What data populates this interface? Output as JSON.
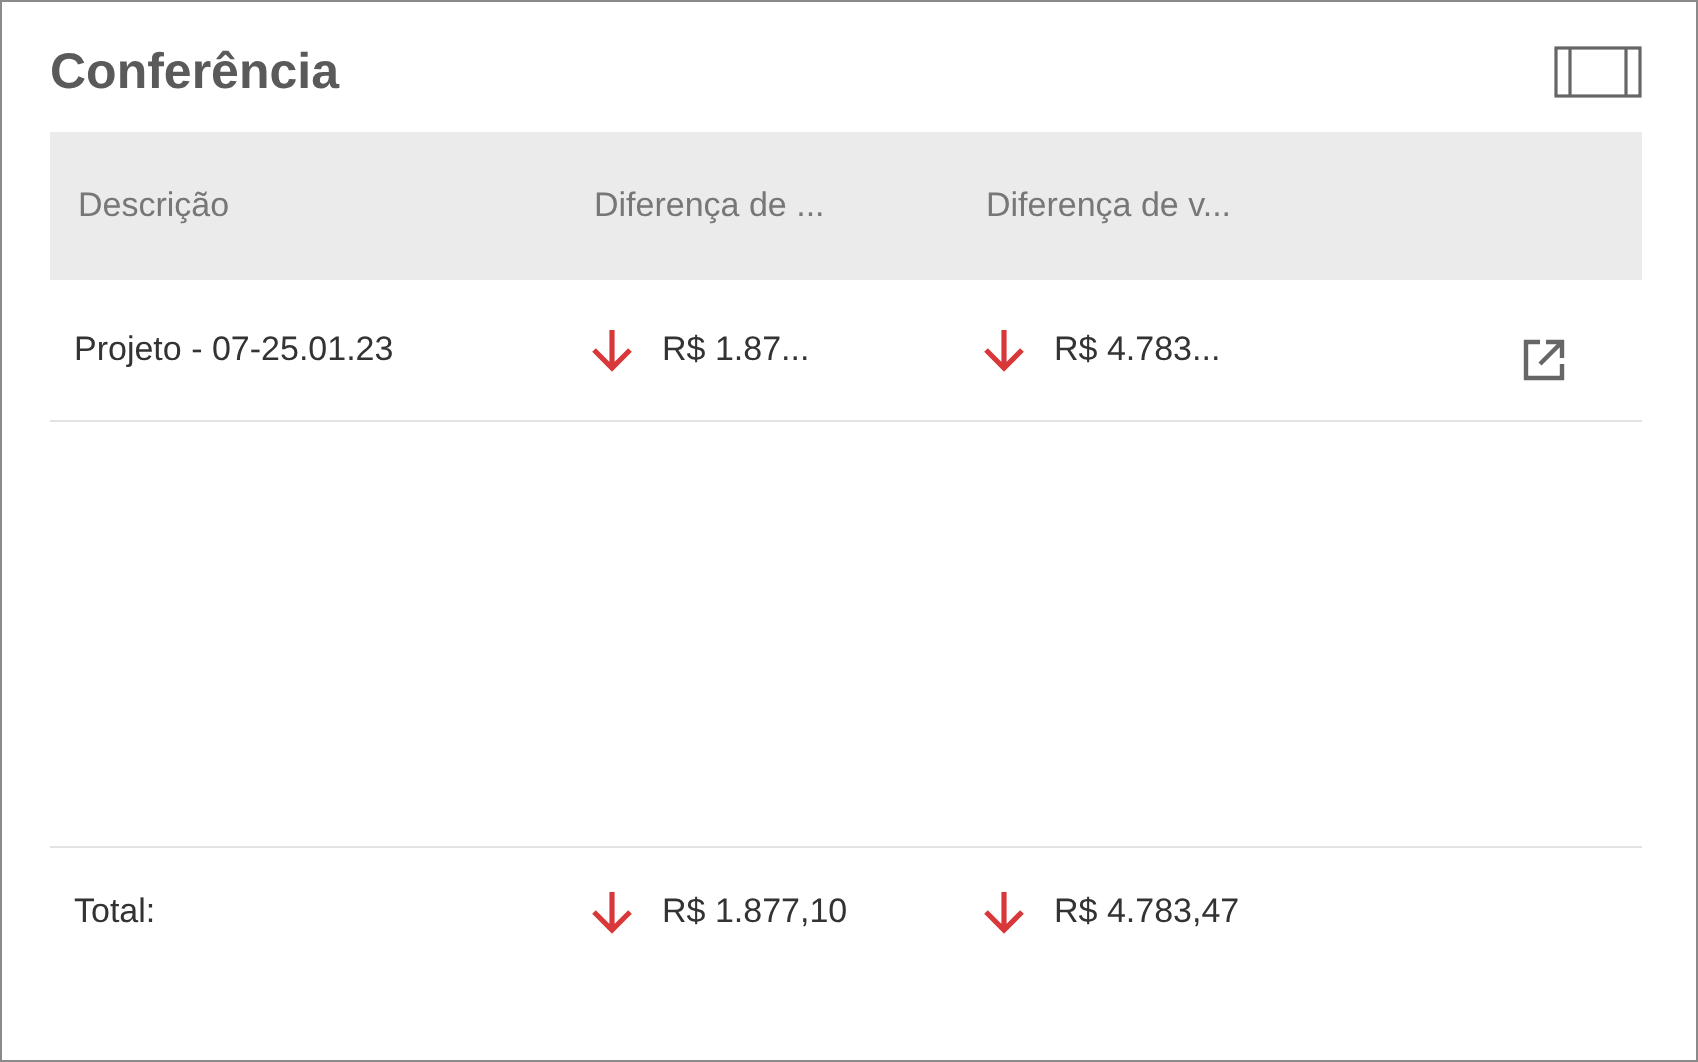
{
  "title": "Conferência",
  "columns": [
    "Descrição",
    "Diferença de ...",
    "Diferença de v..."
  ],
  "rows": [
    {
      "description": "Projeto - 07-25.01.23",
      "values": [
        {
          "text": "R$ 1.87...",
          "decreased": true
        },
        {
          "text": "R$ 4.783...",
          "decreased": true
        }
      ]
    }
  ],
  "total": {
    "label": "Total:",
    "values": [
      {
        "text": "R$ 1.877,10",
        "decreased": true
      },
      {
        "text": "R$ 4.783,47",
        "decreased": true
      }
    ]
  }
}
